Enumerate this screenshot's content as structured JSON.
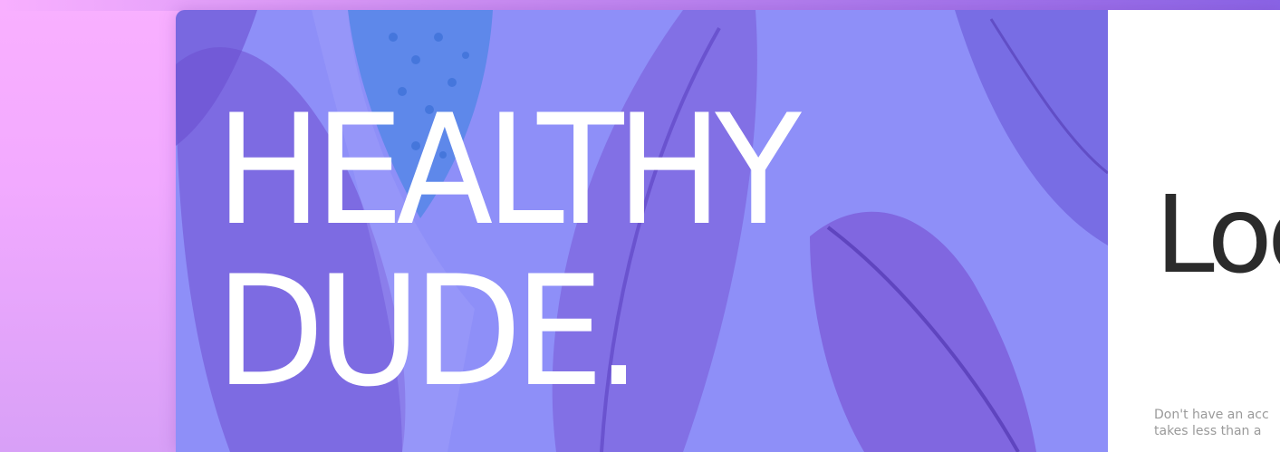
{
  "hero": {
    "title_line_1": "HEALTHY",
    "title_line_2": "DUDE."
  },
  "login_panel": {
    "heading": "Log",
    "signup_prompt": "Don't have an acc\ntakes less than a"
  },
  "colors": {
    "page_background": "#f9b0ff",
    "hero_overlay": "#8e8ff8",
    "feather_purple": "#7a5ad8",
    "feather_blue": "#4f86e8",
    "hero_text": "#ffffff",
    "panel_background": "#ffffff",
    "heading_text": "#2b2b2b",
    "muted_text": "#9a9a9a"
  }
}
